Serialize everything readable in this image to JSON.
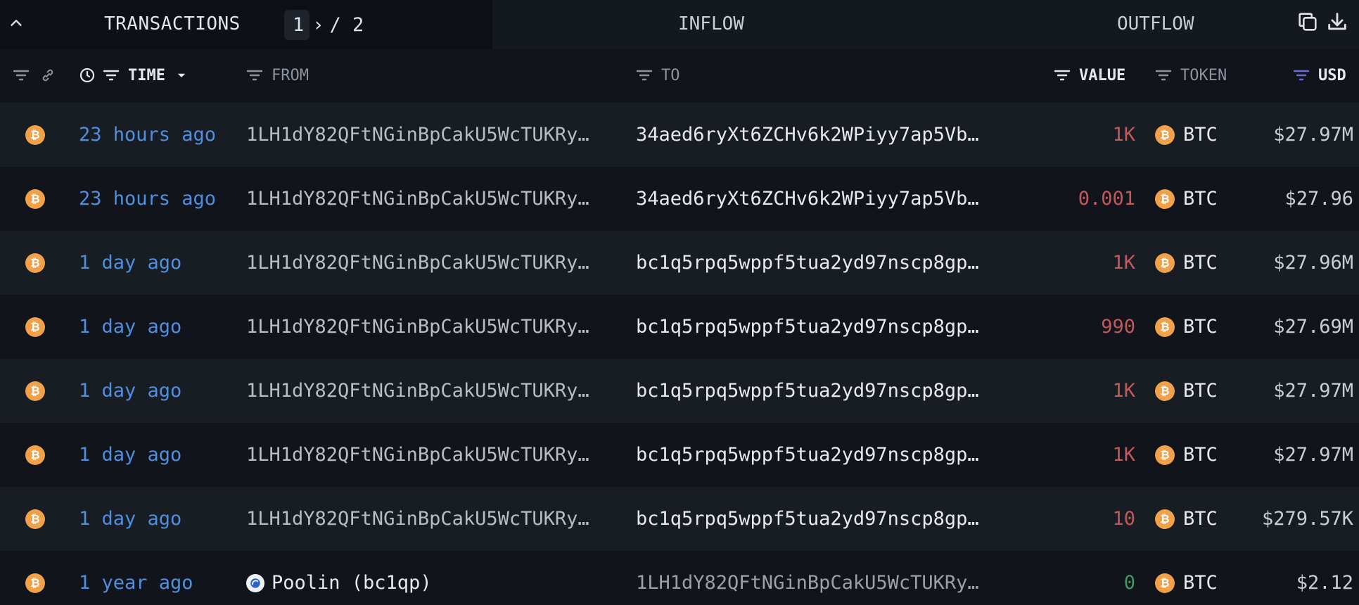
{
  "topbar": {
    "tab_transactions": "TRANSACTIONS",
    "page_current": "1",
    "page_arrow": "›",
    "page_total": "/ 2",
    "tab_inflow": "INFLOW",
    "tab_outflow": "OUTFLOW"
  },
  "header": {
    "time": "TIME",
    "from": "FROM",
    "to": "TO",
    "value": "VALUE",
    "token": "TOKEN",
    "usd": "USD"
  },
  "colors": {
    "time_link": "#4f8fe0",
    "value_out": "#c4585a",
    "value_zero": "#3f9a63",
    "btc_coin": "#f0a14a"
  },
  "rows": [
    {
      "time": "23 hours ago",
      "from": "1LH1dY82QFtNGinBpCakU5WcTUKRy…",
      "to": "34aed6ryXt6ZCHv6k2WPiyy7ap5Vb…",
      "value": "1K",
      "token": "BTC",
      "usd": "$27.97M"
    },
    {
      "time": "23 hours ago",
      "from": "1LH1dY82QFtNGinBpCakU5WcTUKRy…",
      "to": "34aed6ryXt6ZCHv6k2WPiyy7ap5Vb…",
      "value": "0.001",
      "token": "BTC",
      "usd": "$27.96"
    },
    {
      "time": "1 day ago",
      "from": "1LH1dY82QFtNGinBpCakU5WcTUKRy…",
      "to": "bc1q5rpq5wppf5tua2yd97nscp8gp…",
      "value": "1K",
      "token": "BTC",
      "usd": "$27.96M"
    },
    {
      "time": "1 day ago",
      "from": "1LH1dY82QFtNGinBpCakU5WcTUKRy…",
      "to": "bc1q5rpq5wppf5tua2yd97nscp8gp…",
      "value": "990",
      "token": "BTC",
      "usd": "$27.69M"
    },
    {
      "time": "1 day ago",
      "from": "1LH1dY82QFtNGinBpCakU5WcTUKRy…",
      "to": "bc1q5rpq5wppf5tua2yd97nscp8gp…",
      "value": "1K",
      "token": "BTC",
      "usd": "$27.97M"
    },
    {
      "time": "1 day ago",
      "from": "1LH1dY82QFtNGinBpCakU5WcTUKRy…",
      "to": "bc1q5rpq5wppf5tua2yd97nscp8gp…",
      "value": "1K",
      "token": "BTC",
      "usd": "$27.97M"
    },
    {
      "time": "1 day ago",
      "from": "1LH1dY82QFtNGinBpCakU5WcTUKRy…",
      "to": "bc1q5rpq5wppf5tua2yd97nscp8gp…",
      "value": "10",
      "token": "BTC",
      "usd": "$279.57K"
    },
    {
      "time": "1 year ago",
      "from": "Poolin (bc1qp)",
      "to": "1LH1dY82QFtNGinBpCakU5WcTUKRy…",
      "value": "0",
      "token": "BTC",
      "usd": "$2.12"
    }
  ]
}
